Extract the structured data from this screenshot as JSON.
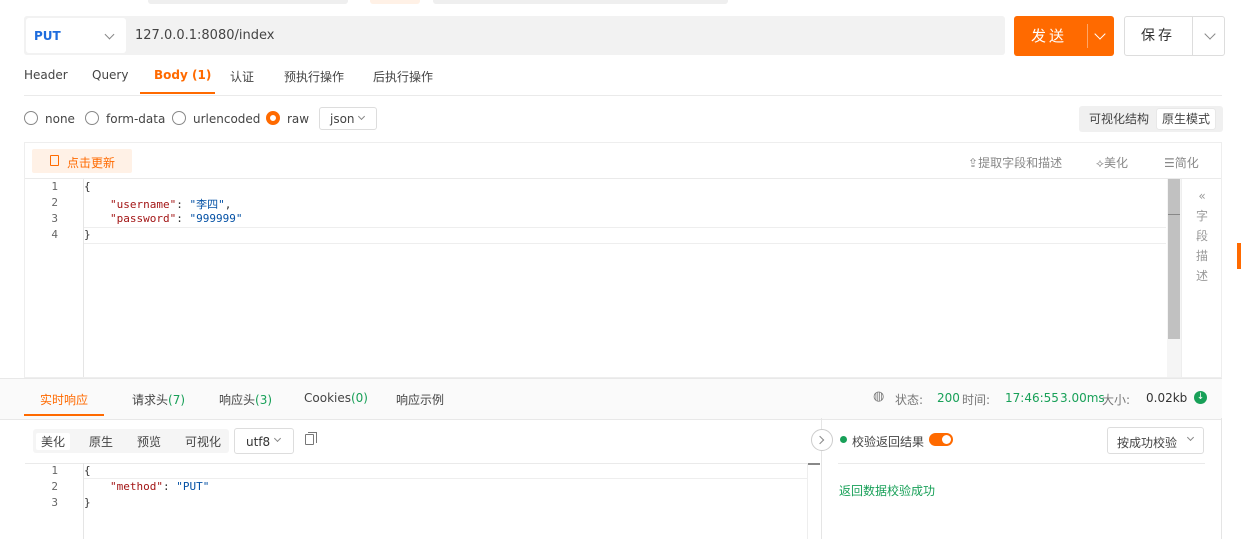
{
  "request": {
    "method": "PUT",
    "url": "127.0.0.1:8080/index",
    "send_label": "发送",
    "save_label": "保存",
    "tabs": [
      {
        "label": "Header"
      },
      {
        "label": "Query"
      },
      {
        "label": "Body (1)"
      },
      {
        "label": "认证"
      },
      {
        "label": "预执行操作"
      },
      {
        "label": "后执行操作"
      }
    ],
    "active_tab": "Body (1)"
  },
  "body": {
    "types": [
      "none",
      "form-data",
      "urlencoded",
      "raw"
    ],
    "selected_type": "raw",
    "format": "json",
    "modes": [
      "可视化结构",
      "原生模式"
    ],
    "active_mode": "原生模式",
    "update_label": "点击更新",
    "tools": [
      "提取字段和描述",
      "美化",
      "简化"
    ],
    "field_desc_label": [
      "字",
      "段",
      "描",
      "述"
    ],
    "editor": {
      "line_numbers": [
        "1",
        "2",
        "3",
        "4"
      ],
      "open_brace": "{",
      "close_brace": "}",
      "k1": "\"username\"",
      "v1": "\"李四\"",
      "k2": "\"password\"",
      "v2": "\"999999\""
    }
  },
  "response": {
    "tabs": [
      {
        "label": "实时响应"
      },
      {
        "label": "请求头",
        "count": "(7)"
      },
      {
        "label": "响应头",
        "count": "(3)"
      },
      {
        "label": "Cookies",
        "count": "(0)"
      },
      {
        "label": "响应示例"
      }
    ],
    "active_tab": "实时响应",
    "status_label": "状态:",
    "status_value": "200",
    "time_label": "时间:",
    "time_value": "17:46:55",
    "duration": "3.00ms",
    "size_label": "大小:",
    "size_value": "0.02kb",
    "view_tools": [
      "美化",
      "原生",
      "预览",
      "可视化"
    ],
    "active_view": "美化",
    "encoding": "utf8",
    "editor": {
      "line_numbers": [
        "1",
        "2",
        "3"
      ],
      "open_brace": "{",
      "close_brace": "}",
      "k1": "\"method\"",
      "v1": "\"PUT\""
    },
    "validate_label": "校验返回结果",
    "validate_enabled": true,
    "validate_mode": "按成功校验",
    "validate_result": "返回数据校验成功"
  },
  "colors": {
    "accent": "#ff6a00",
    "success": "#18a058",
    "method": "#1e6cdd"
  }
}
